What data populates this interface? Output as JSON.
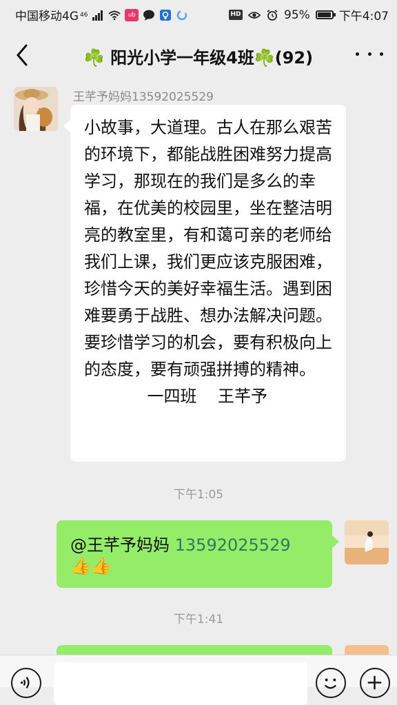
{
  "status_bar": {
    "carrier": "中国移动4G",
    "network_sup": "46",
    "app_badge": "ʊ̶b",
    "hd_label": "HD",
    "battery_percent": "95%",
    "battery_level": 0.95,
    "time": "下午4:07"
  },
  "header": {
    "back_icon": "chevron-left-icon",
    "title": "阳光小学一年级4班",
    "member_count": "(92)",
    "title_emoji": "☘️",
    "more_icon": "more-dots-icon"
  },
  "messages": [
    {
      "direction": "incoming",
      "sender": "王芊予妈妈13592025529",
      "text": "小故事，大道理。古人在那么艰苦的环境下，都能战胜困难努力提高学习，那现在的我们是多么的幸福，在优美的校园里，坐在整洁明亮的教室里，有和蔼可亲的老师给我们上课，我们更应该克服困难，珍惜今天的美好幸福生活。遇到困难要勇于战胜、想办法解决问题。要珍惜学习的机会，要有积极向上的态度，要有顽强拼搏的精神。\n            一四班    王芊予"
    },
    {
      "type": "timestamp",
      "text": "下午1:05"
    },
    {
      "direction": "outgoing",
      "mention": "@王芊予妈妈 ",
      "phone": "13592025529",
      "emoji": "👍👍"
    },
    {
      "type": "timestamp",
      "text": "下午1:41"
    }
  ],
  "input_bar": {
    "voice_icon": "voice-icon",
    "emoji_icon": "emoji-icon",
    "plus_icon": "plus-icon",
    "placeholder": ""
  },
  "colors": {
    "background": "#ededed",
    "incoming_bubble": "#ffffff",
    "outgoing_bubble": "#95ec69",
    "phone_link": "#2f7a5b",
    "clover": "#3aa64a"
  }
}
